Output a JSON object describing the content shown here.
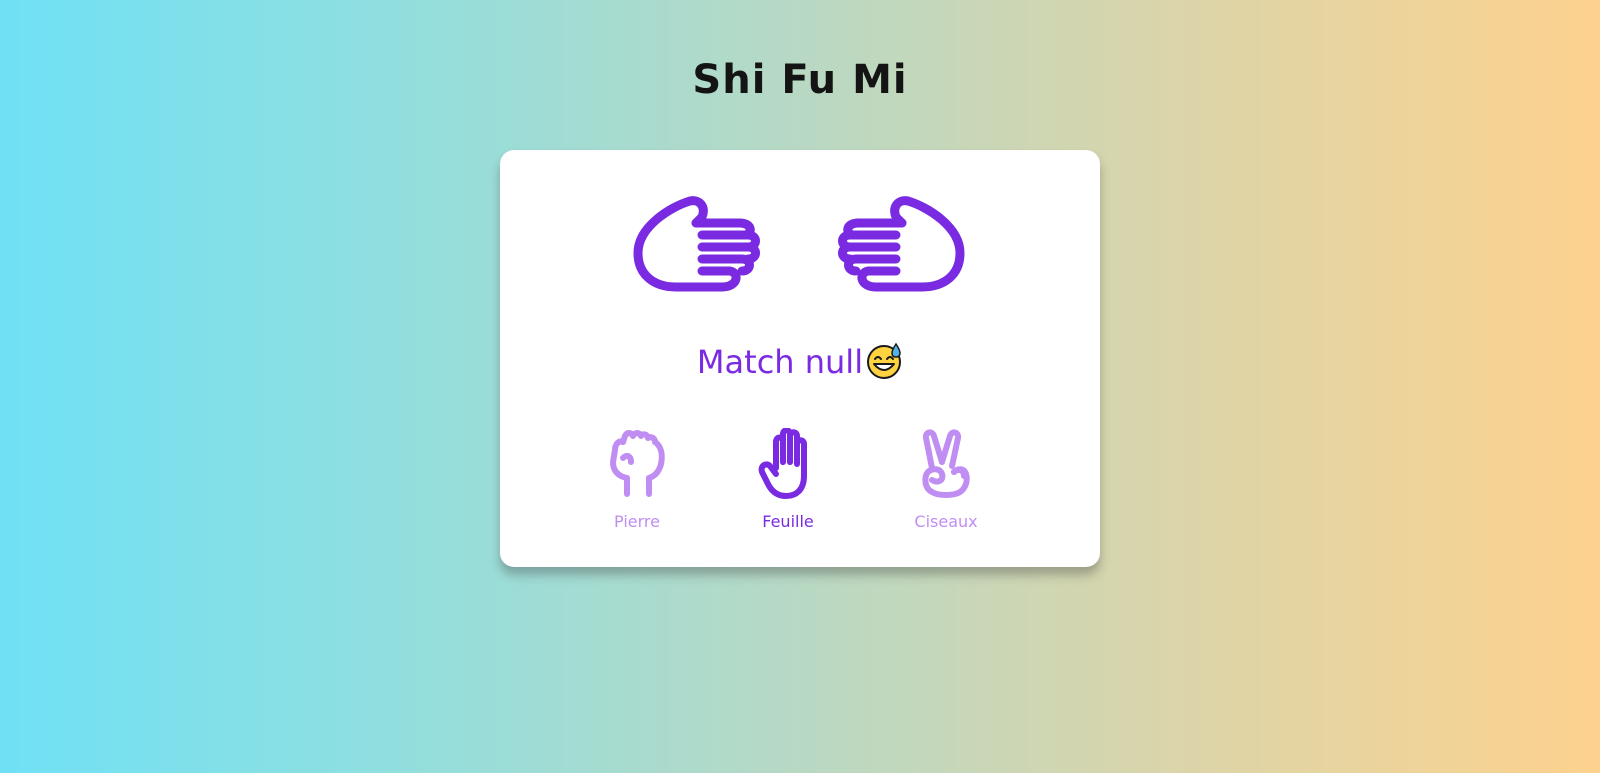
{
  "page": {
    "title": "Shi Fu Mi"
  },
  "game": {
    "player_hand_icon": "open-hand-right-icon",
    "computer_hand_icon": "open-hand-left-icon",
    "result_text": "Match null",
    "result_emoji": "grinning-sweat-face-icon"
  },
  "choices": [
    {
      "label": "Pierre",
      "icon": "fist-icon",
      "selected": false
    },
    {
      "label": "Feuille",
      "icon": "raised-hand-icon",
      "selected": true
    },
    {
      "label": "Ciseaux",
      "icon": "victory-hand-icon",
      "selected": false
    }
  ],
  "colors": {
    "accent": "#7a2be2",
    "accent_dim": "#c08ef2",
    "title": "#141414",
    "gradient_left": "#6fe1f5",
    "gradient_right": "#fdd28e"
  }
}
